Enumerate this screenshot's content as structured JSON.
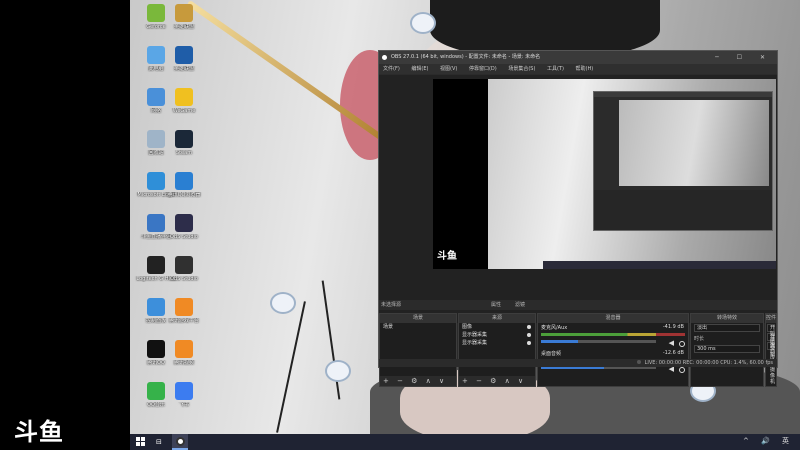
{
  "stream_logo": "斗鱼",
  "desktop_icons": [
    {
      "label": "Geforce",
      "color": "#7ab83b"
    },
    {
      "label": "英雄联盟",
      "color": "#c79a3c"
    },
    {
      "label": "此电脑",
      "color": "#5aa6e6"
    },
    {
      "label": "英雄联盟",
      "color": "#1f5da8"
    },
    {
      "label": "网络",
      "color": "#4a90d9"
    },
    {
      "label": "WeGame",
      "color": "#f0c020"
    },
    {
      "label": "回收站",
      "color": "#9fb4c8"
    },
    {
      "label": "Steam",
      "color": "#1b2838"
    },
    {
      "label": "Microsoft Edge",
      "color": "#2f8fd8"
    },
    {
      "label": "腾讯QQ浏览器",
      "color": "#2a7fd2"
    },
    {
      "label": "斗鱼直播伴侣",
      "color": "#3a76c4"
    },
    {
      "label": "OBS Studio",
      "color": "#2d2d4a"
    },
    {
      "label": "Logitech G HUB",
      "color": "#222222"
    },
    {
      "label": "OBS Studio",
      "color": "#303030"
    },
    {
      "label": "控制面板",
      "color": "#3d8fdb"
    },
    {
      "label": "腾讯游戏平台",
      "color": "#f08a24"
    },
    {
      "label": "腾讯QQ",
      "color": "#111111"
    },
    {
      "label": "腾讯视频",
      "color": "#f08a24"
    },
    {
      "label": "QQ音乐",
      "color": "#36b24a"
    },
    {
      "label": "飞书",
      "color": "#3c7cf0"
    }
  ],
  "obs": {
    "title": "OBS 27.0.1 (64 bit, windows) - 配置文件: 未命名 - 场景: 未命名",
    "menu": [
      "文件(F)",
      "编辑(E)",
      "视图(V)",
      "停靠窗口(D)",
      "场景集合(S)",
      "工具(T)",
      "帮助(H)"
    ],
    "window_buttons": "─ ☐ ✕",
    "preview_logo": "斗鱼",
    "toolbar": {
      "selected": "未选择源",
      "properties": "属性",
      "filters": "滤镜"
    },
    "docks": {
      "scenes": {
        "title": "场景",
        "items": [
          "场景"
        ]
      },
      "sources": {
        "title": "来源",
        "items": [
          "图像",
          "显示器采集",
          "显示器采集"
        ]
      },
      "mixer": {
        "title": "混音器",
        "channels": [
          {
            "name": "麦克风/Aux",
            "db": "-41.9 dB",
            "level": 0.32
          },
          {
            "name": "桌面音频",
            "db": "-12.6 dB",
            "level": 0.55
          }
        ]
      },
      "transitions": {
        "title": "转场特效",
        "type": "淡出",
        "duration_label": "时长",
        "duration": "300 ms"
      },
      "controls": {
        "title": "控件",
        "buttons": [
          "开始推流",
          "开始录制",
          "启动虚拟摄像机"
        ]
      }
    },
    "footer_icons": "+ − ⚙ ∧ ∨",
    "status": "LIVE: 00:00:00   REC: 00:00:00   CPU: 1.4%, 60.00 fps"
  },
  "taskbar": {
    "task_view": "⊟",
    "tray": "^ 🔊 英"
  }
}
